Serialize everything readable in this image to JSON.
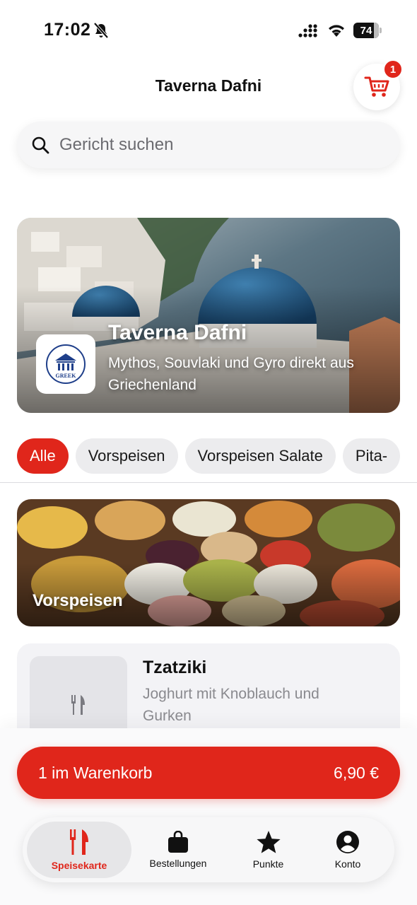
{
  "status_bar": {
    "time": "17:02",
    "battery": "74"
  },
  "header": {
    "title": "Taverna Dafni",
    "cart_count": "1"
  },
  "search": {
    "placeholder": "Gericht suchen"
  },
  "hero": {
    "title": "Taverna Dafni",
    "subtitle": "Mythos, Souvlaki und Gyro direkt aus Griechenland",
    "logo_text": "GREEK"
  },
  "categories": [
    {
      "label": "Alle",
      "active": true
    },
    {
      "label": "Vorspeisen",
      "active": false
    },
    {
      "label": "Vorspeisen Salate",
      "active": false
    },
    {
      "label": "Pita-",
      "active": false
    }
  ],
  "section": {
    "title": "Vorspeisen"
  },
  "products": [
    {
      "name": "Tzatziki",
      "description": "Joghurt mit Knoblauch und Gurken"
    }
  ],
  "cart_bar": {
    "label": "1 im Warenkorb",
    "total": "6,90 €"
  },
  "tabs": [
    {
      "label": "Speisekarte",
      "icon": "fork-knife-icon",
      "active": true
    },
    {
      "label": "Bestellungen",
      "icon": "bag-icon",
      "active": false
    },
    {
      "label": "Punkte",
      "icon": "star-icon",
      "active": false
    },
    {
      "label": "Konto",
      "icon": "account-icon",
      "active": false
    }
  ],
  "colors": {
    "accent": "#e0261b",
    "chip_bg": "#ececee",
    "card_bg": "#f3f3f6"
  }
}
